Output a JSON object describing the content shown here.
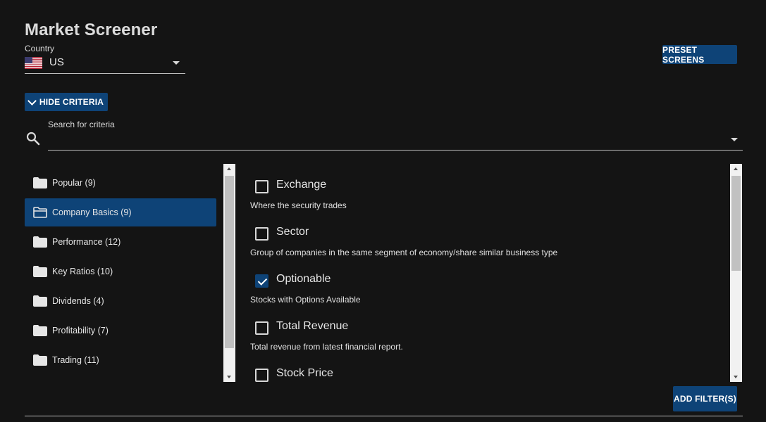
{
  "header": {
    "title": "Market Screener",
    "preset_label": "PRESET SCREENS"
  },
  "country": {
    "label": "Country",
    "value": "US",
    "flag_icon": "us-flag-icon"
  },
  "criteria_toggle": {
    "label": "HIDE CRITERIA"
  },
  "search": {
    "label": "Search for criteria",
    "value": ""
  },
  "categories": [
    {
      "label": "Popular (9)",
      "selected": false
    },
    {
      "label": "Company Basics (9)",
      "selected": true
    },
    {
      "label": "Performance (12)",
      "selected": false
    },
    {
      "label": "Key Ratios (10)",
      "selected": false
    },
    {
      "label": "Dividends (4)",
      "selected": false
    },
    {
      "label": "Profitability (7)",
      "selected": false
    },
    {
      "label": "Trading (11)",
      "selected": false
    }
  ],
  "criteria": [
    {
      "name": "Exchange",
      "description": "Where the security trades",
      "checked": false
    },
    {
      "name": "Sector",
      "description": "Group of companies in the same segment of economy/share similar business type",
      "checked": false
    },
    {
      "name": "Optionable",
      "description": "Stocks with Options Available",
      "checked": true
    },
    {
      "name": "Total Revenue",
      "description": "Total revenue from latest financial report.",
      "checked": false
    },
    {
      "name": "Stock Price",
      "description": "",
      "checked": false
    }
  ],
  "actions": {
    "add_filter_label": "ADD FILTER(S)"
  },
  "colors": {
    "background": "#141414",
    "accent": "#0e4377",
    "text": "#e6e6e6"
  }
}
